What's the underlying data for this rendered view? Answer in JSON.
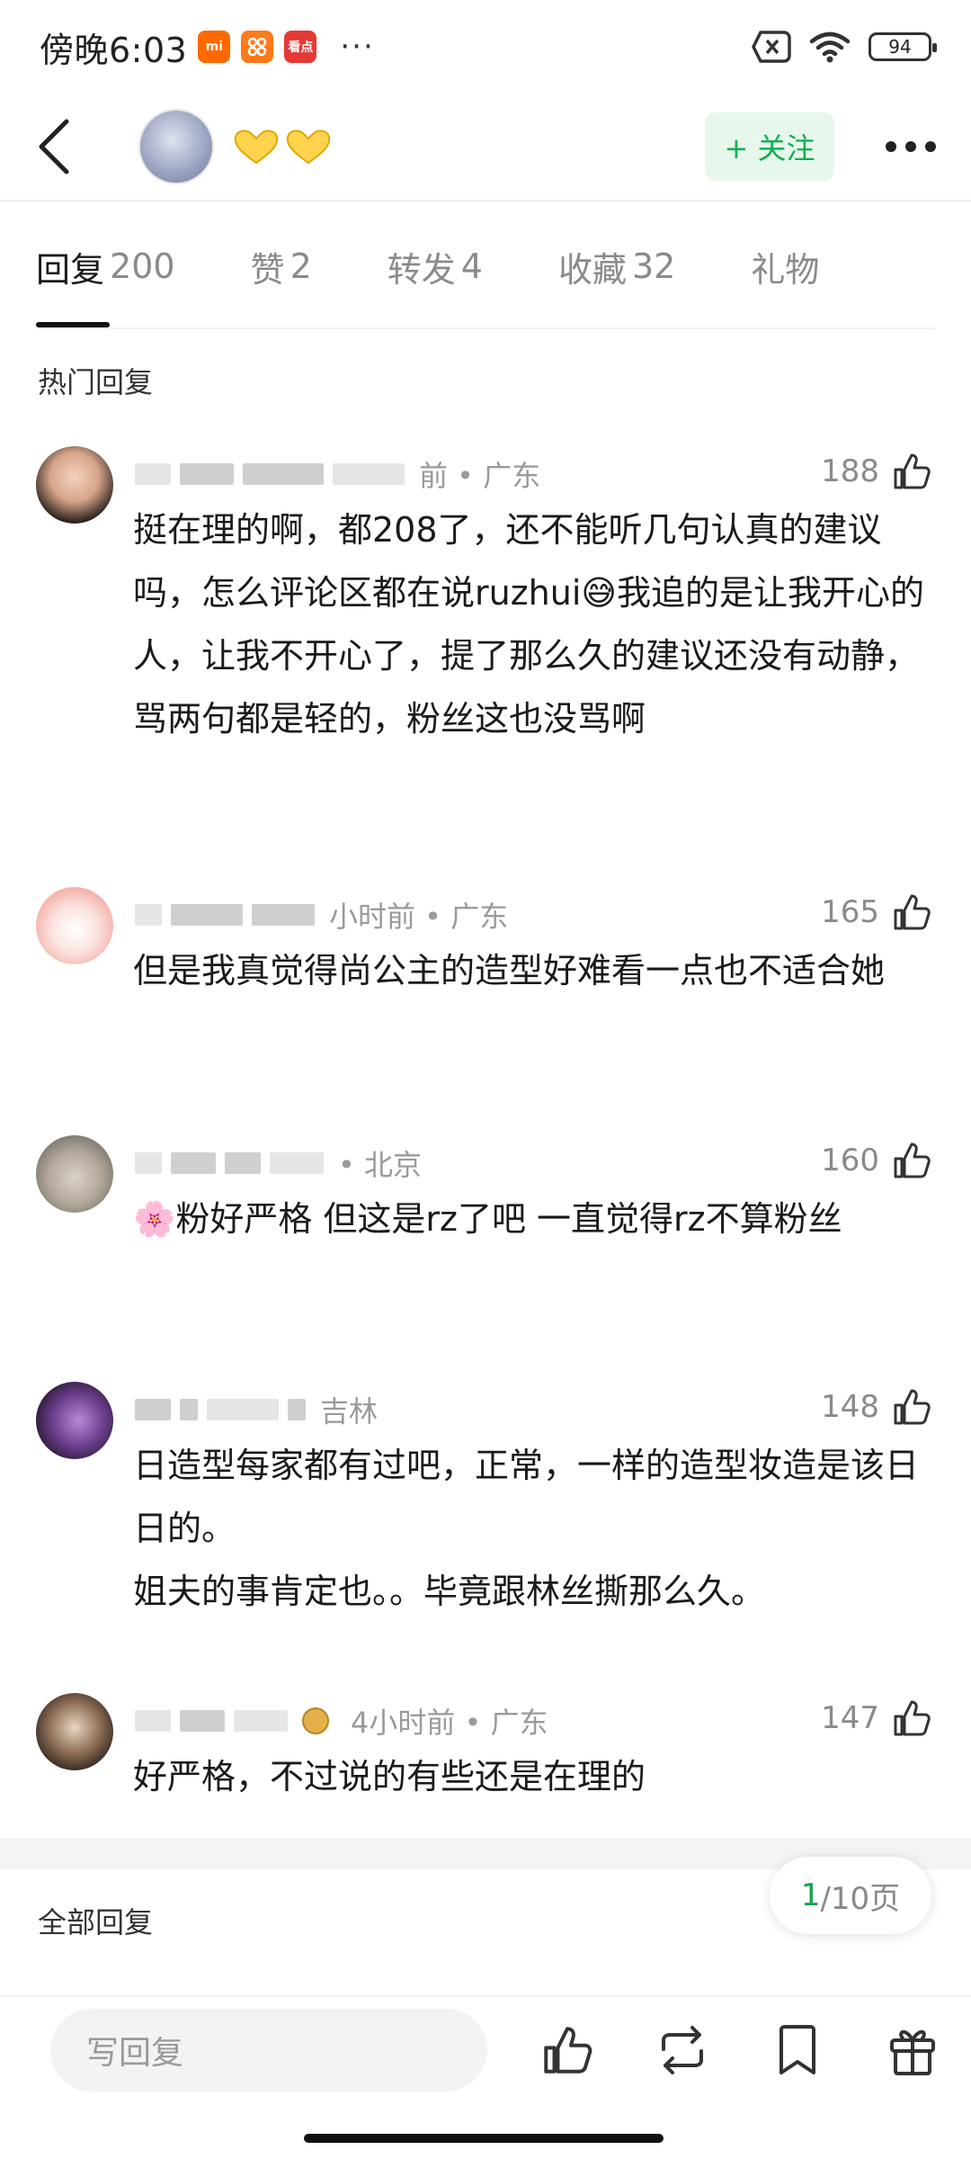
{
  "status_bar": {
    "time": "傍晚6:03",
    "apps": [
      {
        "name": "mi-app-icon",
        "label": "mi",
        "color": "#ff6900"
      },
      {
        "name": "shop-app-icon",
        "label": "",
        "color": "#ff7a1a"
      },
      {
        "name": "news-app-icon",
        "label": "看点",
        "color": "#e53935"
      }
    ],
    "more": "···",
    "battery": "94"
  },
  "header": {
    "follow_label": "+ 关注"
  },
  "tabs": [
    {
      "label": "回复",
      "count": "200"
    },
    {
      "label": "赞",
      "count": "2"
    },
    {
      "label": "转发",
      "count": "4"
    },
    {
      "label": "收藏",
      "count": "32"
    },
    {
      "label": "礼物",
      "count": ""
    }
  ],
  "hot_replies_title": "热门回复",
  "comments": [
    {
      "time_location": "前 • 广东",
      "likes": "188",
      "text": "挺在理的啊，都208了，还不能听几句认真的建议吗，怎么评论区都在说ruzhui😅我追的是让我开心的人，让我不开心了，提了那么久的建议还没有动静，骂两句都是轻的，粉丝这也没骂啊"
    },
    {
      "time_location": "小时前 • 广东",
      "likes": "165",
      "text": "但是我真觉得尚公主的造型好难看一点也不适合她"
    },
    {
      "time_location": "• 北京",
      "likes": "160",
      "text": "🌸粉好严格 但这是rz了吧 一直觉得rz不算粉丝"
    },
    {
      "time_location": "吉林",
      "likes": "148",
      "text": "日造型每家都有过吧，正常，一样的造型妆造是该日日的。\n姐夫的事肯定也。。毕竟跟林丝撕那么久。"
    },
    {
      "time_location": "4小时前 • 广东",
      "likes": "147",
      "text": "好严格，不过说的有些还是在理的"
    }
  ],
  "all_replies_title": "全部回复",
  "pagination": {
    "current": "1",
    "total": "/10页"
  },
  "bottom_bar": {
    "reply_placeholder": "写回复"
  }
}
